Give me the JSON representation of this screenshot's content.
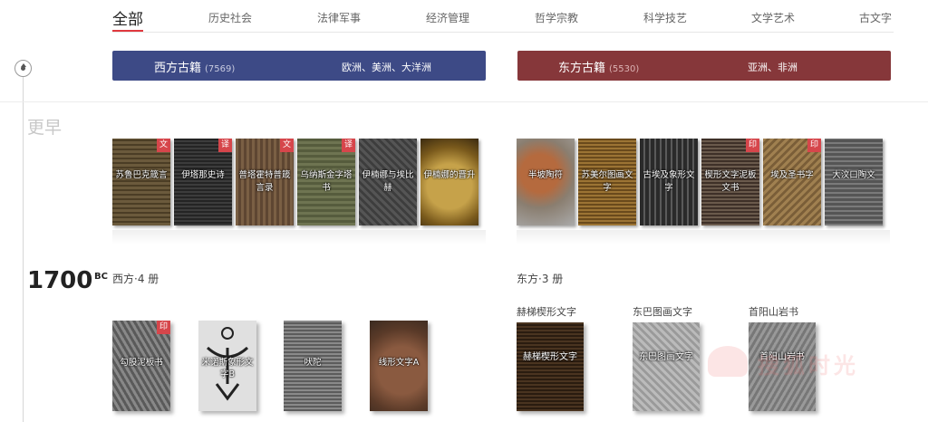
{
  "nav": {
    "items": [
      "全部",
      "历史社会",
      "法律军事",
      "经济管理",
      "哲学宗教",
      "科学技艺",
      "文学艺术",
      "古文字"
    ]
  },
  "banners": {
    "west": {
      "name": "西方古籍",
      "count": "(7569)",
      "regions": "欧洲、美洲、大洋洲"
    },
    "east": {
      "name": "东方古籍",
      "count": "(5530)",
      "regions": "亚洲、非洲"
    }
  },
  "eras": {
    "earlier": {
      "label": "更早"
    },
    "bc1700": {
      "year": "1700",
      "suffix": "BC",
      "west_count": "西方·4 册",
      "east_count": "东方·3 册"
    }
  },
  "shelf_earlier": {
    "west": [
      {
        "title": "苏鲁巴克箴言",
        "tag": "文"
      },
      {
        "title": "伊塔那史诗",
        "tag": "译"
      },
      {
        "title": "普塔霍特普箴言录",
        "tag": "文"
      },
      {
        "title": "乌纳斯金字塔书",
        "tag": "译"
      },
      {
        "title": "伊楠娜与埃比赫",
        "tag": ""
      },
      {
        "title": "伊楠娜的晋升",
        "tag": ""
      }
    ],
    "east": [
      {
        "title": "半坡陶符",
        "tag": ""
      },
      {
        "title": "苏美尔图画文字",
        "tag": ""
      },
      {
        "title": "古埃及象形文字",
        "tag": ""
      },
      {
        "title": "楔形文字泥板文书",
        "tag": "印"
      },
      {
        "title": "埃及圣书字",
        "tag": "印"
      },
      {
        "title": "大汶口陶文",
        "tag": ""
      }
    ]
  },
  "shelf_1700": {
    "west": [
      {
        "title": "勾股泥板书",
        "tag": "印"
      },
      {
        "title": "米诺斯象形文字B",
        "tag": ""
      },
      {
        "title": "吠陀",
        "tag": ""
      },
      {
        "title": "线形文字A",
        "tag": ""
      }
    ],
    "east": [
      {
        "heading": "赫梯楔形文字",
        "title": "赫梯楔形文字"
      },
      {
        "heading": "东巴图画文字",
        "title": "东巴图画文字"
      },
      {
        "heading": "首阳山岩书",
        "title": "首阳山岩书"
      }
    ]
  },
  "watermark": "搜狐时光",
  "colors": {
    "accent": "#e0393e",
    "west": "#3d4a86",
    "east": "#86373a",
    "tag": "#d6464b"
  }
}
